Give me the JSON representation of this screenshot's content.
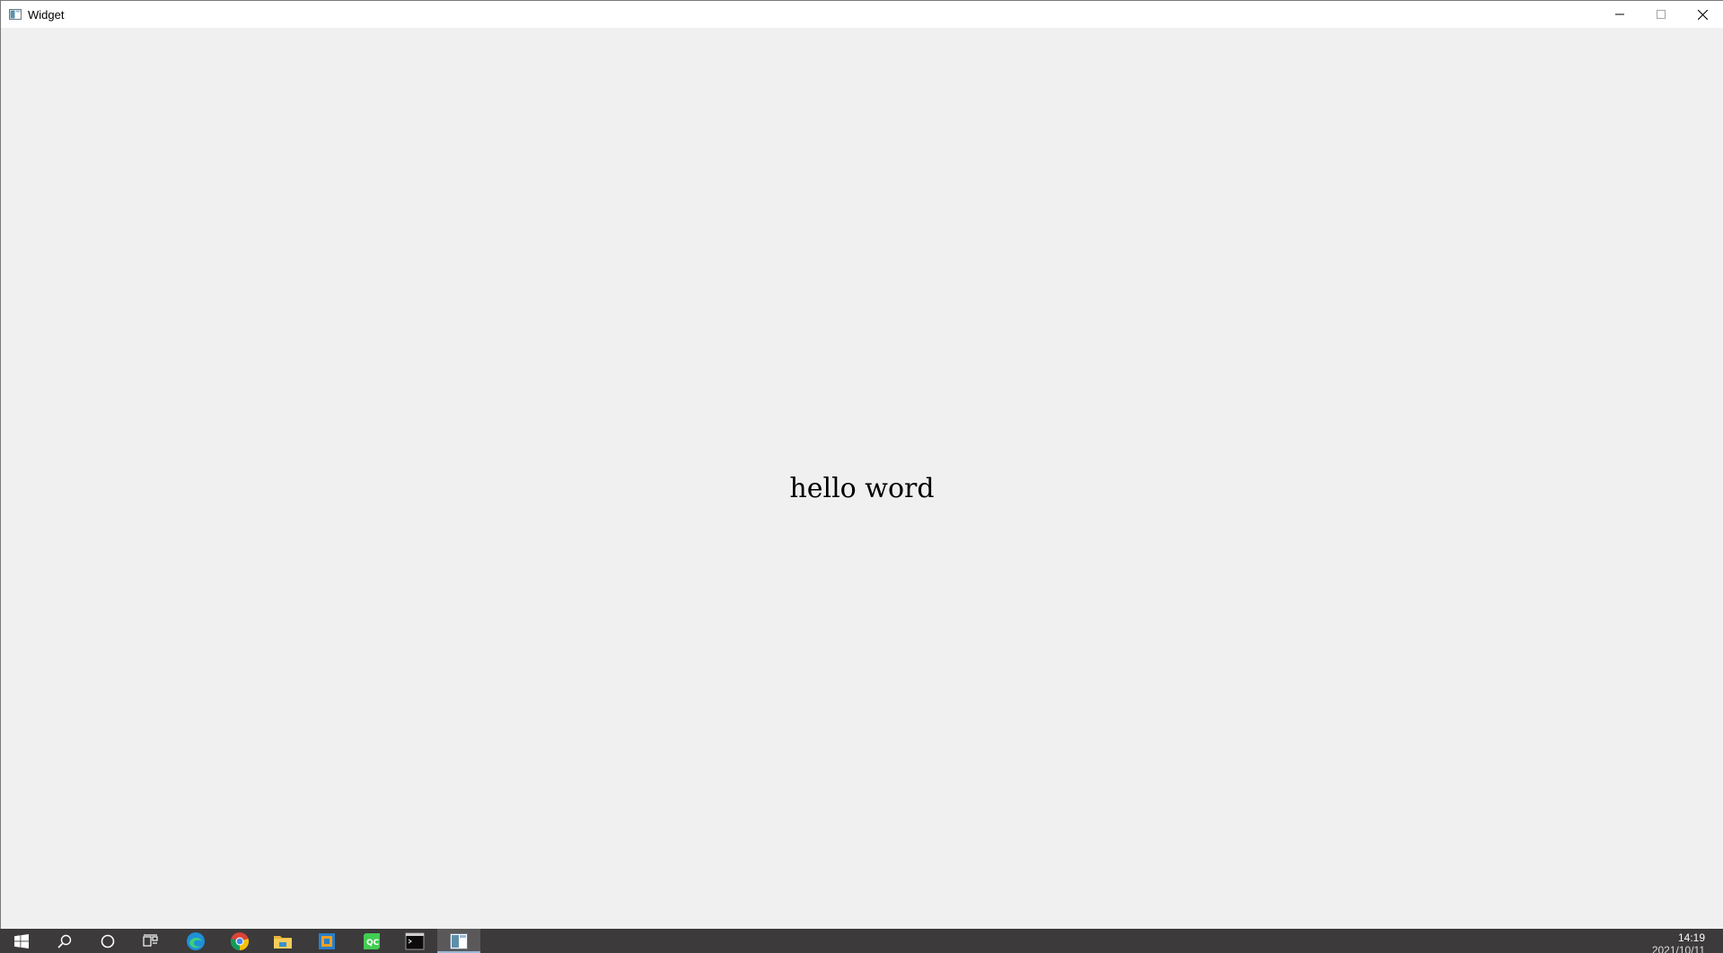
{
  "window": {
    "title": "Widget",
    "icon": "qt-app-window-icon",
    "caption_buttons": [
      {
        "name": "minimize-button",
        "icon": "minimize-icon",
        "enabled": true
      },
      {
        "name": "maximize-button",
        "icon": "maximize-icon",
        "enabled": false
      },
      {
        "name": "close-button",
        "icon": "close-icon",
        "enabled": true
      }
    ]
  },
  "content": {
    "label_text": "hello word"
  },
  "taskbar": {
    "items": [
      {
        "name": "start-button",
        "icon": "windows-start-icon"
      },
      {
        "name": "search-button",
        "icon": "search-icon"
      },
      {
        "name": "cortana-button",
        "icon": "cortana-circle-icon"
      },
      {
        "name": "task-view-button",
        "icon": "task-view-icon"
      },
      {
        "name": "edge-app",
        "icon": "edge-icon"
      },
      {
        "name": "chrome-app",
        "icon": "chrome-icon"
      },
      {
        "name": "file-explorer-app",
        "icon": "folder-icon"
      },
      {
        "name": "app-generic",
        "icon": "app-window-icon"
      },
      {
        "name": "qt-creator-app",
        "icon": "qt-creator-icon"
      },
      {
        "name": "terminal-app",
        "icon": "terminal-icon"
      },
      {
        "name": "widget-app",
        "icon": "qt-app-window-icon",
        "active": true
      }
    ],
    "clock": {
      "time": "14:19",
      "date": "2021/10/11"
    },
    "colors": {
      "background": "#3c3a3b",
      "active_item": "#5a5859"
    }
  }
}
